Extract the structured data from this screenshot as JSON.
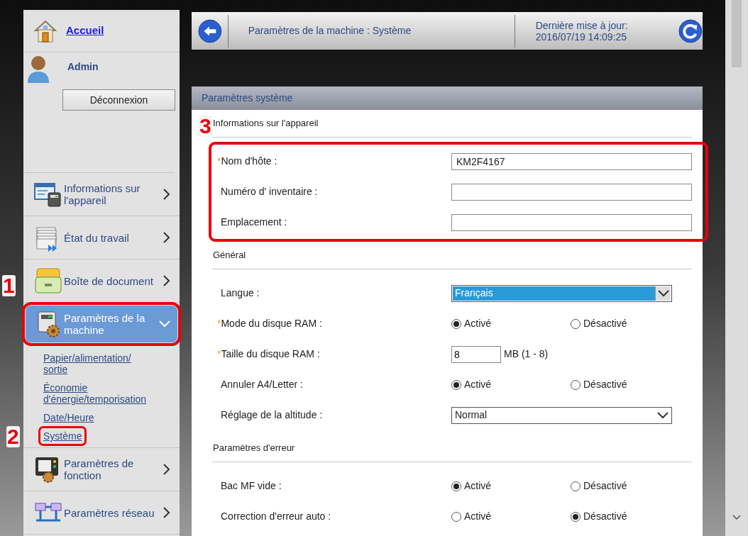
{
  "sidebar": {
    "home": {
      "label": "Accueil"
    },
    "user": {
      "name": "Admin"
    },
    "logout_button": "Déconnexion",
    "items": [
      {
        "label": "Informations sur l'appareil",
        "selected": false,
        "expanded": false,
        "highlighted": false
      },
      {
        "label": "État du travail",
        "selected": false,
        "expanded": false,
        "highlighted": false
      },
      {
        "label": "Boîte de document",
        "selected": false,
        "expanded": false,
        "highlighted": false,
        "callout": "1"
      },
      {
        "label": "Paramètres de la machine",
        "selected": true,
        "expanded": true,
        "highlighted": true,
        "children": [
          {
            "label": "Papier/alimentation/ sortie",
            "highlighted": false
          },
          {
            "label": "Économie d'énergie/temporisation",
            "highlighted": false
          },
          {
            "label": "Date/Heure",
            "highlighted": false
          },
          {
            "label": "Système",
            "highlighted": true,
            "callout": "2"
          }
        ]
      },
      {
        "label": "Paramètres de fonction",
        "selected": false,
        "expanded": false,
        "highlighted": false
      },
      {
        "label": "Paramètres réseau",
        "selected": false,
        "expanded": false,
        "highlighted": false
      }
    ]
  },
  "header": {
    "title": "Paramètres de la machine : Système",
    "last_update_label": "Dernière mise à jour:",
    "last_update": "2016/07/19 14:09:25"
  },
  "panel": {
    "title": "Paramètres système",
    "sections": [
      {
        "title": "Informations sur l'appareil",
        "highlighted": true,
        "callout": "3",
        "rows": [
          {
            "kind": "text",
            "label": "Nom d'hôte :",
            "required_mark": "*",
            "value": "KM2F4167"
          },
          {
            "kind": "text",
            "label": "Numéro d' inventaire :"
          },
          {
            "kind": "text",
            "label": "Emplacement :"
          }
        ]
      },
      {
        "title": "Général",
        "highlighted": false,
        "rows": [
          {
            "kind": "select",
            "label": "Langue :",
            "value": "Français",
            "focused": true
          },
          {
            "kind": "radio",
            "label": "Mode du disque RAM :",
            "required_mark": "*",
            "options": [
              {
                "label": "Activé",
                "selected": true
              },
              {
                "label": "Désactivé",
                "selected": false
              }
            ]
          },
          {
            "kind": "number",
            "label": "Taille du disque RAM :",
            "required_mark": "*",
            "value": "8",
            "unit": "MB (1 - 8)"
          },
          {
            "kind": "radio",
            "label": "Annuler A4/Letter  :",
            "options": [
              {
                "label": "Activé",
                "selected": true
              },
              {
                "label": "Désactivé",
                "selected": false
              }
            ]
          },
          {
            "kind": "select",
            "label": "Réglage de la altitude :",
            "value": "Normal",
            "focused": false
          }
        ]
      },
      {
        "title": "Paramètres d'erreur",
        "highlighted": false,
        "rows": [
          {
            "kind": "radio",
            "label": "Bac MF vide :",
            "options": [
              {
                "label": "Activé",
                "selected": true
              },
              {
                "label": "Désactivé",
                "selected": false
              }
            ]
          },
          {
            "kind": "radio",
            "label": "Correction d'erreur auto :",
            "options": [
              {
                "label": "Activé",
                "selected": false
              },
              {
                "label": "Désactivé",
                "selected": true
              }
            ]
          }
        ]
      }
    ]
  }
}
